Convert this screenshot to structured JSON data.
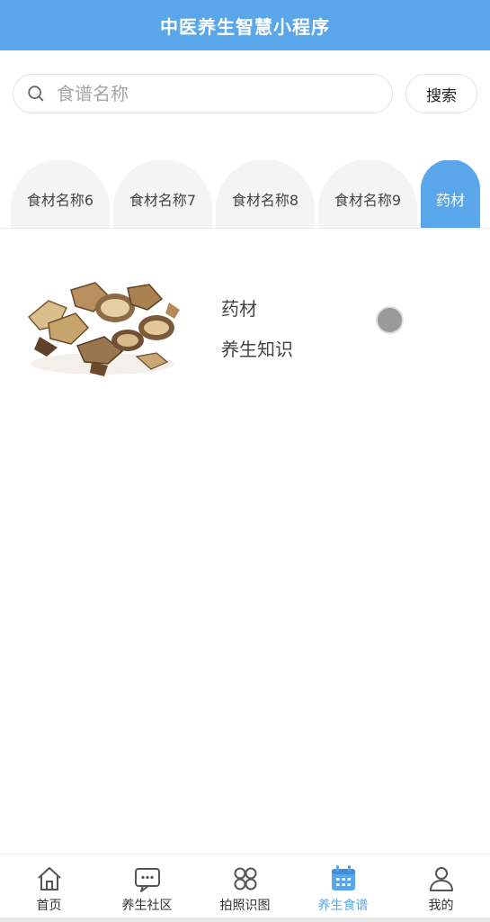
{
  "header": {
    "title": "中医养生智慧小程序"
  },
  "search": {
    "placeholder": "食谱名称",
    "value": "",
    "button_label": "搜索"
  },
  "tabs": [
    {
      "label": "食材名称6",
      "active": false
    },
    {
      "label": "食材名称7",
      "active": false
    },
    {
      "label": "食材名称8",
      "active": false
    },
    {
      "label": "食材名称9",
      "active": false
    },
    {
      "label": "药材",
      "active": true
    }
  ],
  "items": [
    {
      "title": "药材",
      "subtitle": "养生知识",
      "image": "herb-bark-image"
    }
  ],
  "bottom_nav": [
    {
      "label": "首页",
      "icon": "home-icon",
      "active": false
    },
    {
      "label": "养生社区",
      "icon": "chat-icon",
      "active": false
    },
    {
      "label": "拍照识图",
      "icon": "grid-icon",
      "active": false
    },
    {
      "label": "养生食谱",
      "icon": "calendar-icon",
      "active": true
    },
    {
      "label": "我的",
      "icon": "user-icon",
      "active": false
    }
  ],
  "colors": {
    "primary": "#5aa6ea",
    "tab_bg": "#f4f4f4",
    "text": "#333333"
  }
}
